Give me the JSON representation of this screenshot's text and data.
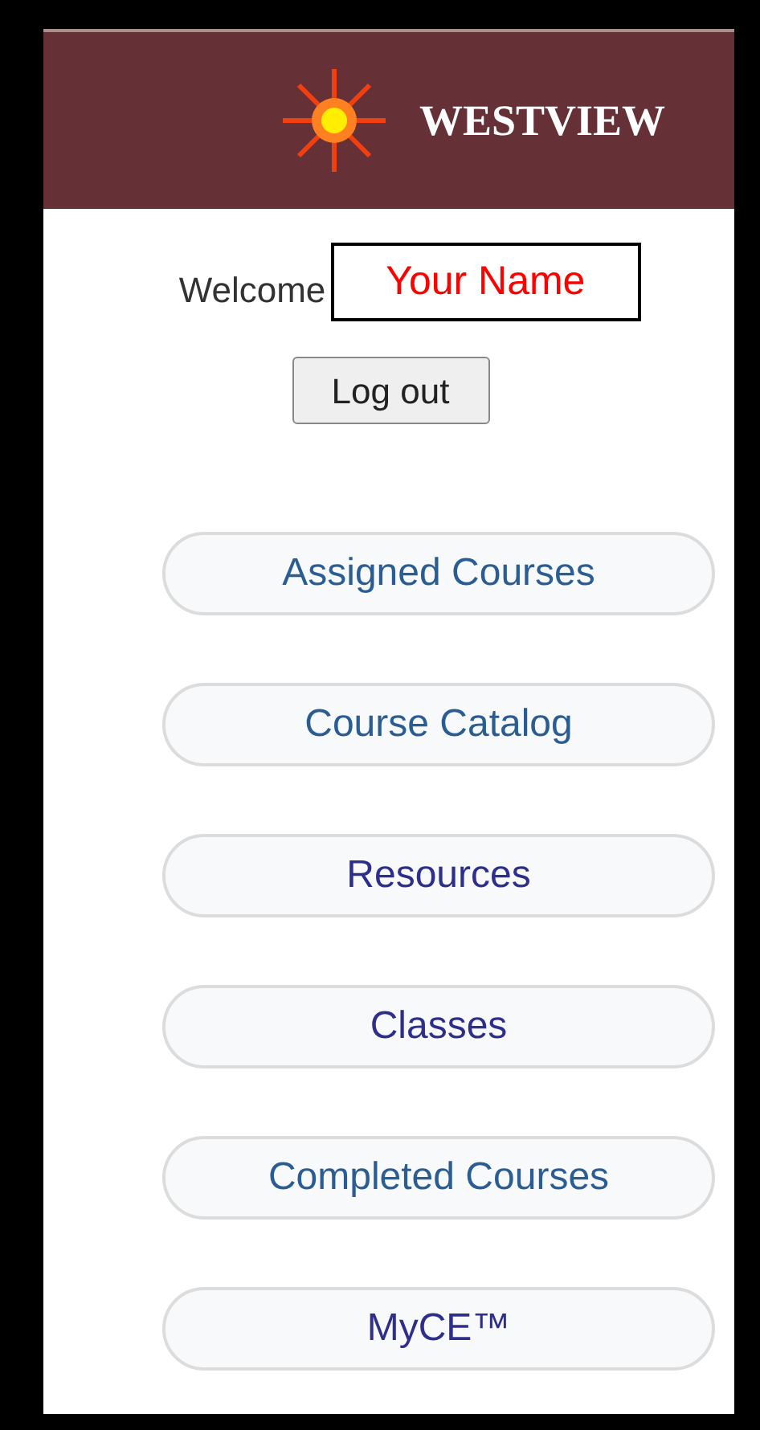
{
  "header": {
    "title": "WESTVIEW"
  },
  "welcome": {
    "label": "Welcome",
    "name": "Your Name"
  },
  "logout_button": "Log out",
  "nav_buttons": [
    {
      "label": "Assigned Courses",
      "color": "#2a5d93"
    },
    {
      "label": "Course Catalog",
      "color": "#2a5d93"
    },
    {
      "label": "Resources",
      "color": "#2e2e8c"
    },
    {
      "label": "Classes",
      "color": "#2e2e8c"
    },
    {
      "label": "Completed Courses",
      "color": "#2a5d93"
    },
    {
      "label": "MyCE™",
      "color": "#2e2e8c"
    }
  ]
}
